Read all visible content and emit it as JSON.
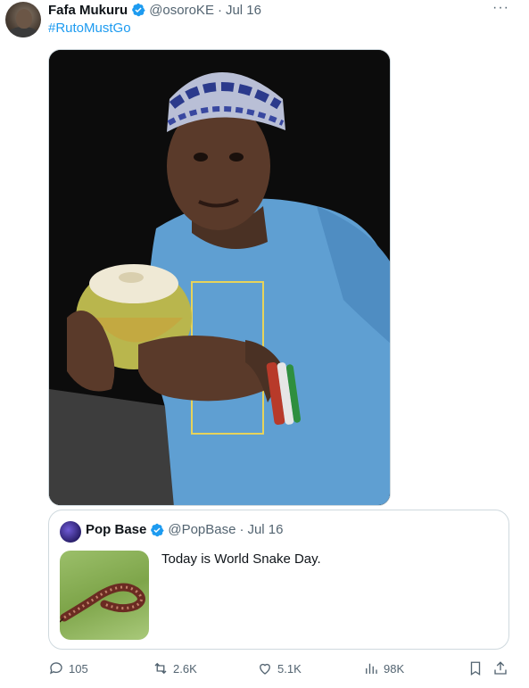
{
  "author": {
    "name": "Fafa Mukuru",
    "handle": "@osoroKE",
    "separator": "·",
    "date": "Jul 16"
  },
  "post_text": "#RutoMustGo",
  "more_label": "···",
  "quote": {
    "name": "Pop Base",
    "handle": "@PopBase",
    "separator": "·",
    "date": "Jul 16",
    "text": "Today is World Snake Day."
  },
  "actions": {
    "replies": "105",
    "reposts": "2.6K",
    "likes": "5.1K",
    "views": "98K"
  },
  "colors": {
    "accent": "#1d9bf0",
    "muted": "#536471",
    "text": "#0f1419",
    "border": "#cfd9de"
  },
  "icons": [
    "verified-badge-icon",
    "more-icon",
    "reply-icon",
    "repost-icon",
    "like-icon",
    "views-icon",
    "bookmark-icon",
    "share-icon"
  ]
}
